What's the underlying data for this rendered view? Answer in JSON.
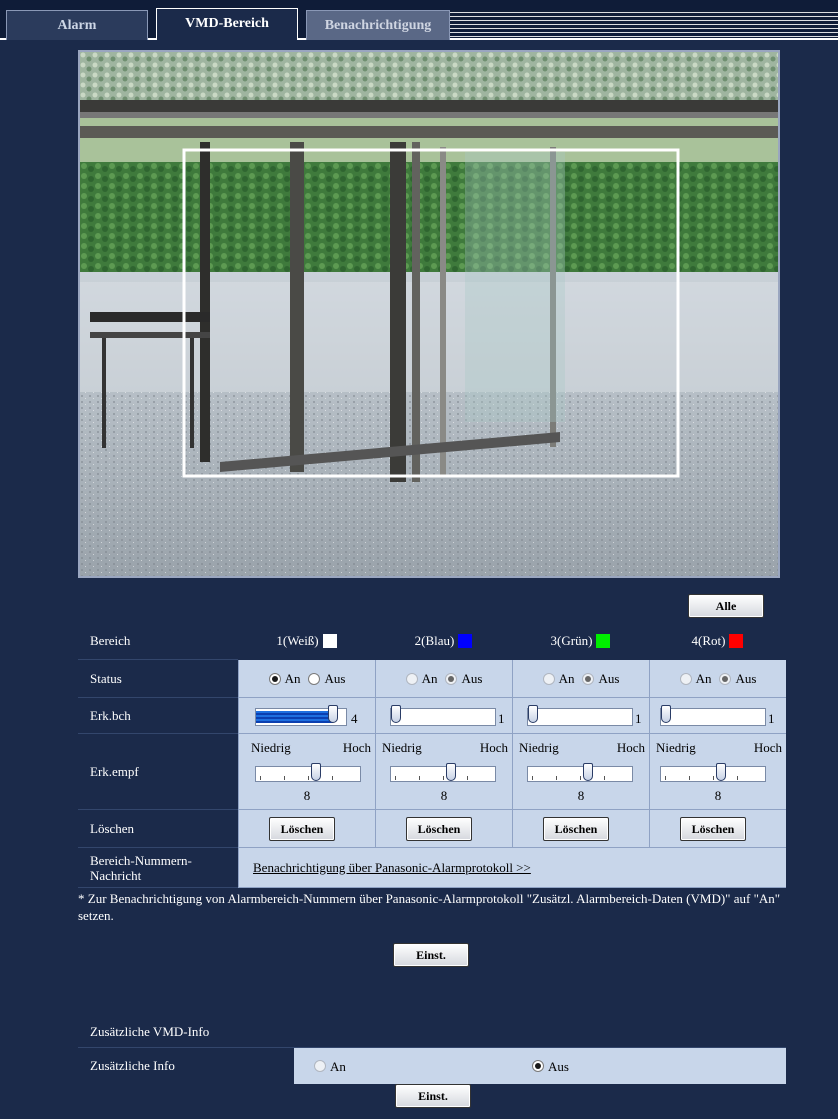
{
  "tabs": [
    {
      "label": "Alarm"
    },
    {
      "label": "VMD-Bereich"
    },
    {
      "label": "Benachrichtigung"
    }
  ],
  "area_table": {
    "all_button": "Alle",
    "row_labels": {
      "area": "Bereich",
      "status": "Status",
      "detection_area": "Erk.bch",
      "sensitivity": "Erk.empf",
      "delete": "Löschen",
      "area_number_msg": "Bereich-Nummern-Nachricht"
    },
    "areas": [
      {
        "name": "1(Weiß)",
        "color": "#ffffff",
        "status_on": "An",
        "status_off": "Aus",
        "status": "An",
        "detect_value": "4",
        "detect_fraction": 0.85,
        "sens_low": "Niedrig",
        "sens_high": "Hoch",
        "sens_value": "8",
        "sens_fraction": 0.58,
        "delete_label": "Löschen"
      },
      {
        "name": "2(Blau)",
        "color": "#0000ff",
        "status_on": "An",
        "status_off": "Aus",
        "status": "Aus",
        "detect_value": "1",
        "detect_fraction": 0.0,
        "sens_low": "Niedrig",
        "sens_high": "Hoch",
        "sens_value": "8",
        "sens_fraction": 0.58,
        "delete_label": "Löschen"
      },
      {
        "name": "3(Grün)",
        "color": "#00ee00",
        "status_on": "An",
        "status_off": "Aus",
        "status": "Aus",
        "detect_value": "1",
        "detect_fraction": 0.0,
        "sens_low": "Niedrig",
        "sens_high": "Hoch",
        "sens_value": "8",
        "sens_fraction": 0.58,
        "delete_label": "Löschen"
      },
      {
        "name": "4(Rot)",
        "color": "#ff0000",
        "status_on": "An",
        "status_off": "Aus",
        "status": "Aus",
        "detect_value": "1",
        "detect_fraction": 0.0,
        "sens_low": "Niedrig",
        "sens_high": "Hoch",
        "sens_value": "8",
        "sens_fraction": 0.58,
        "delete_label": "Löschen"
      }
    ],
    "notification_link": "Benachrichtigung über Panasonic-Alarmprotokoll >>"
  },
  "note": "* Zur Benachrichtigung von Alarmbereich-Nummern über Panasonic-Alarmprotokoll \"Zusätzl. Alarmbereich-Daten (VMD)\" auf \"An\" setzen.",
  "set_button_1": "Einst.",
  "extra_info": {
    "section_title": "Zusätzliche VMD-Info",
    "row_label": "Zusätzliche Info",
    "option_on": "An",
    "option_off": "Aus",
    "selected": "Aus"
  },
  "set_button_2": "Einst.",
  "colors": {
    "background": "#1b2a4a",
    "cell": "#c8d6ea",
    "area1": "#ffffff",
    "area2": "#0000ff",
    "area3": "#00ee00",
    "area4": "#ff0000"
  }
}
